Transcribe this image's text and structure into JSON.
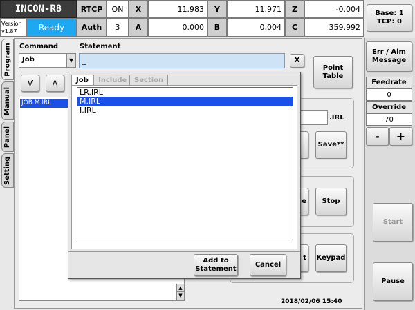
{
  "header": {
    "logo": "INCON-R8",
    "version_label": "Version",
    "version": "v1.87",
    "status": "Ready",
    "rtcp_label": "RTCP",
    "rtcp_value": "ON",
    "auth_label": "Auth",
    "auth_value": "3",
    "coords": [
      {
        "label": "X",
        "value": "11.983"
      },
      {
        "label": "Y",
        "value": "11.971"
      },
      {
        "label": "Z",
        "value": "-0.004"
      },
      {
        "label": "A",
        "value": "0.000"
      },
      {
        "label": "B",
        "value": "0.004"
      },
      {
        "label": "C",
        "value": "359.992"
      }
    ],
    "base_tcp": "Base: 1\nTCP: 0"
  },
  "side_tabs": [
    "Program",
    "Manual",
    "Panel",
    "Setting"
  ],
  "program": {
    "command_label": "Command",
    "statement_label": "Statement",
    "command_value": "Job",
    "statement_value": "_",
    "clear_label": "X",
    "down_label": "V",
    "up_label": "Λ",
    "point_table_label": "Point\nTable",
    "job_list": [
      "JOB M.IRL"
    ],
    "irl_suffix": ".IRL",
    "save_label": "Save**",
    "stop_label": "Stop",
    "keypad_label": "Keypad",
    "partial_e": "e",
    "partial_t": "t",
    "timestamp": "2018/02/06 15:40"
  },
  "popup": {
    "tabs": [
      "Job",
      "Include",
      "Section"
    ],
    "files": [
      "LR.IRL",
      "M.IRL",
      "I.IRL"
    ],
    "selected_file": "M.IRL",
    "add_label": "Add to\nStatement",
    "cancel_label": "Cancel"
  },
  "right_panel": {
    "err_alm": "Err / Alm\nMessage",
    "feedrate_label": "Feedrate",
    "feedrate_value": "0",
    "override_label": "Override",
    "override_value": "70",
    "minus": "-",
    "plus": "+",
    "start": "Start",
    "pause": "Pause"
  },
  "colors": {
    "ready": "#1ea7f2",
    "selection": "#1a4fe8",
    "statement_bg": "#cfe3f7"
  }
}
